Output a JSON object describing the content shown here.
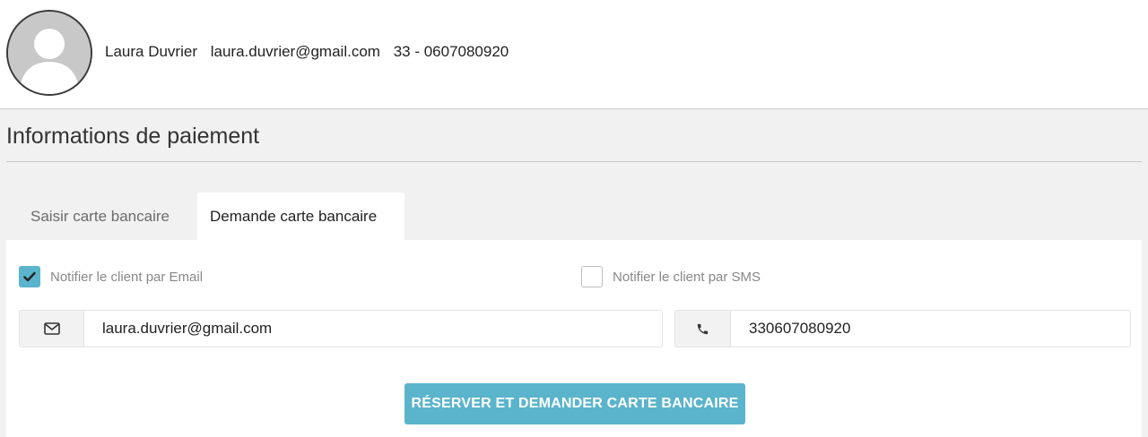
{
  "user": {
    "name": "Laura Duvrier",
    "email": "laura.duvrier@gmail.com",
    "phone": "33 - 0607080920",
    "avatar_icon": "user-silhouette-icon"
  },
  "section": {
    "title": "Informations de paiement"
  },
  "tabs": [
    {
      "label": "Saisir carte bancaire",
      "active": false
    },
    {
      "label": "Demande carte bancaire",
      "active": true
    }
  ],
  "notifications": {
    "email_label": "Notifier le client par Email",
    "email_checked": true,
    "sms_label": "Notifier le client par SMS",
    "sms_checked": false
  },
  "fields": {
    "email_value": "laura.duvrier@gmail.com",
    "email_icon": "envelope-icon",
    "phone_value": "330607080920",
    "phone_icon": "phone-icon"
  },
  "actions": {
    "submit_label": "RÉSERVER ET DEMANDER CARTE BANCAIRE"
  },
  "colors": {
    "accent": "#5ab4cc",
    "background": "#f1f1f1",
    "panel": "#ffffff"
  }
}
